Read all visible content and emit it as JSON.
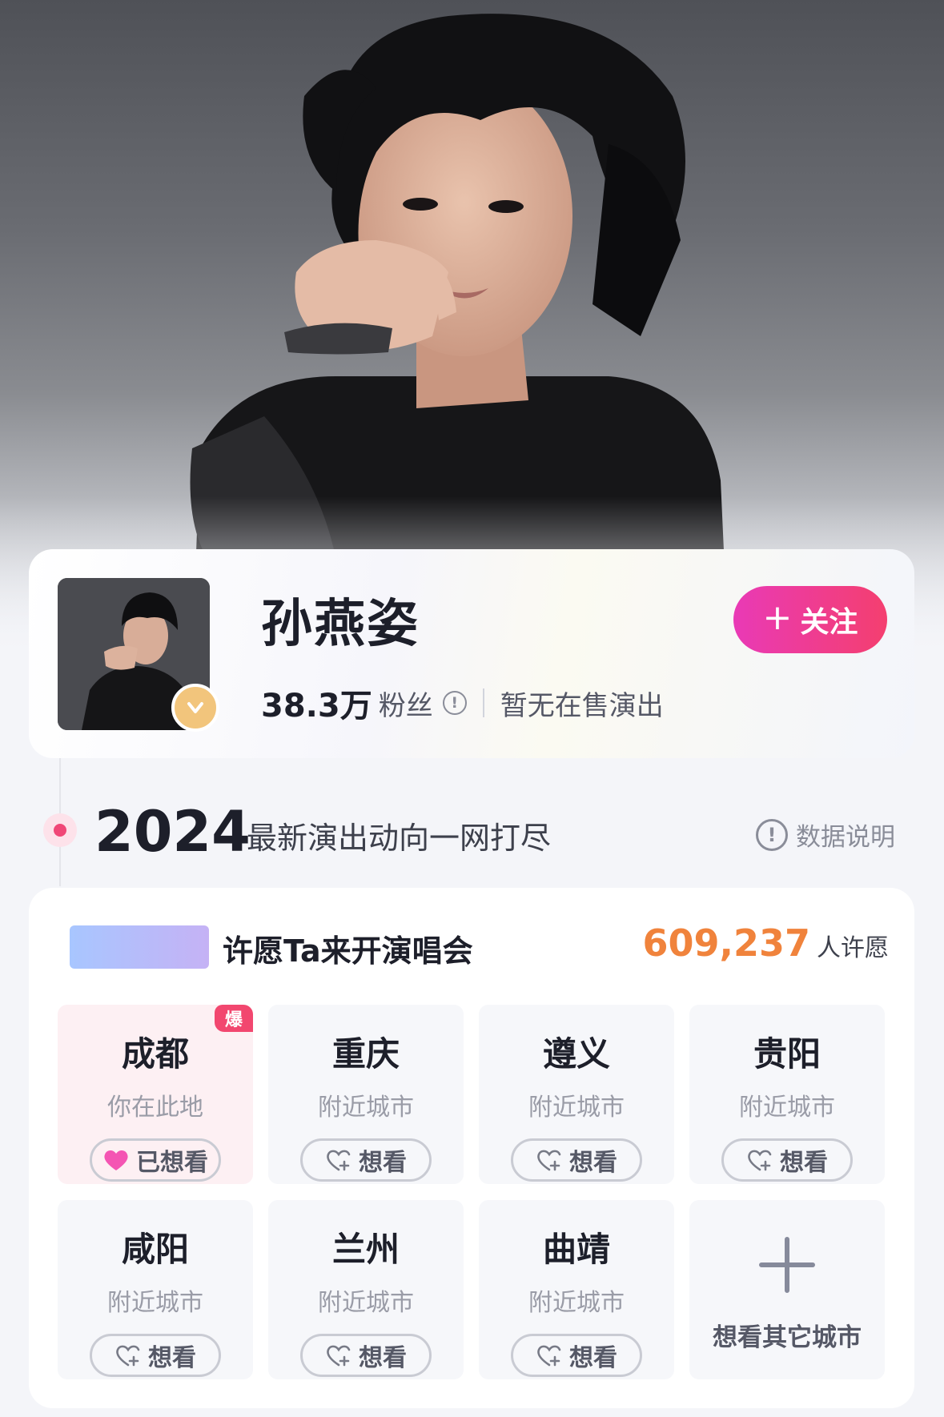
{
  "artist": {
    "name": "孙燕姿",
    "fans_count": "38.3万",
    "fans_label": "粉丝",
    "no_show_text": "暂无在售演出"
  },
  "follow_button": {
    "plus": "+",
    "label": "关注"
  },
  "timeline": {
    "year": "2024",
    "subtitle": "最新演出动向一网打尽",
    "data_note": "数据说明",
    "info_glyph": "!"
  },
  "wish": {
    "title": "许愿Ta来开演唱会",
    "count": "609,237",
    "count_label": "人许愿",
    "cities": [
      {
        "name": "成都",
        "sub": "你在此地",
        "button": "已想看",
        "wanted": true,
        "hot_badge": "爆"
      },
      {
        "name": "重庆",
        "sub": "附近城市",
        "button": "想看",
        "wanted": false
      },
      {
        "name": "遵义",
        "sub": "附近城市",
        "button": "想看",
        "wanted": false
      },
      {
        "name": "贵阳",
        "sub": "附近城市",
        "button": "想看",
        "wanted": false
      },
      {
        "name": "咸阳",
        "sub": "附近城市",
        "button": "想看",
        "wanted": false
      },
      {
        "name": "兰州",
        "sub": "附近城市",
        "button": "想看",
        "wanted": false
      },
      {
        "name": "曲靖",
        "sub": "附近城市",
        "button": "想看",
        "wanted": false
      }
    ],
    "more_label": "想看其它城市"
  },
  "colors": {
    "accent_pink": "#f04777",
    "follow_gradient_start": "#e93ab6",
    "follow_gradient_end": "#f43f6f",
    "wish_count_orange": "#f0833c",
    "verified_badge": "#f2c57c"
  },
  "icons": {
    "verified": "verified-v-icon",
    "info": "info-icon",
    "heart_filled": "heart-filled-icon",
    "heart_add": "heart-plus-icon",
    "plus": "plus-icon"
  }
}
